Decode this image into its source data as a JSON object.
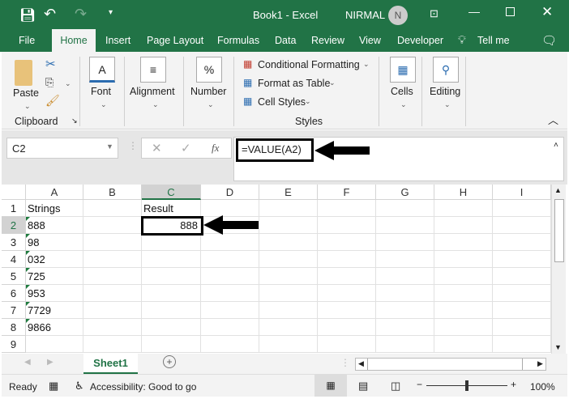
{
  "title_bar": {
    "title": "Book1  -  Excel",
    "user": "NIRMAL",
    "avatar_initial": "N"
  },
  "tabs": [
    "File",
    "Home",
    "Insert",
    "Page Layout",
    "Formulas",
    "Data",
    "Review",
    "View",
    "Developer",
    "Tell me"
  ],
  "active_tab": "Home",
  "ribbon": {
    "paste": "Paste",
    "clipboard": "Clipboard",
    "font": "Font",
    "alignment": "Alignment",
    "number": "Number",
    "conditional_formatting": "Conditional Formatting",
    "format_as_table": "Format as Table",
    "cell_styles": "Cell Styles",
    "styles": "Styles",
    "cells": "Cells",
    "editing": "Editing"
  },
  "formula_bar": {
    "name_box": "C2",
    "formula": "=VALUE(A2)"
  },
  "columns": [
    "A",
    "B",
    "C",
    "D",
    "E",
    "F",
    "G",
    "H",
    "I"
  ],
  "rows": [
    "1",
    "2",
    "3",
    "4",
    "5",
    "6",
    "7",
    "8",
    "9"
  ],
  "cells": {
    "A1": "Strings",
    "C1": "Result",
    "A2": "888",
    "A3": "98",
    "A4": "032",
    "A5": "725",
    "A6": "953",
    "A7": "7729",
    "A8": "9866",
    "C2": "888"
  },
  "sheet_tab": "Sheet1",
  "status": {
    "ready": "Ready",
    "accessibility": "Accessibility: Good to go",
    "zoom": "100%"
  },
  "colors": {
    "accent": "#217346"
  }
}
